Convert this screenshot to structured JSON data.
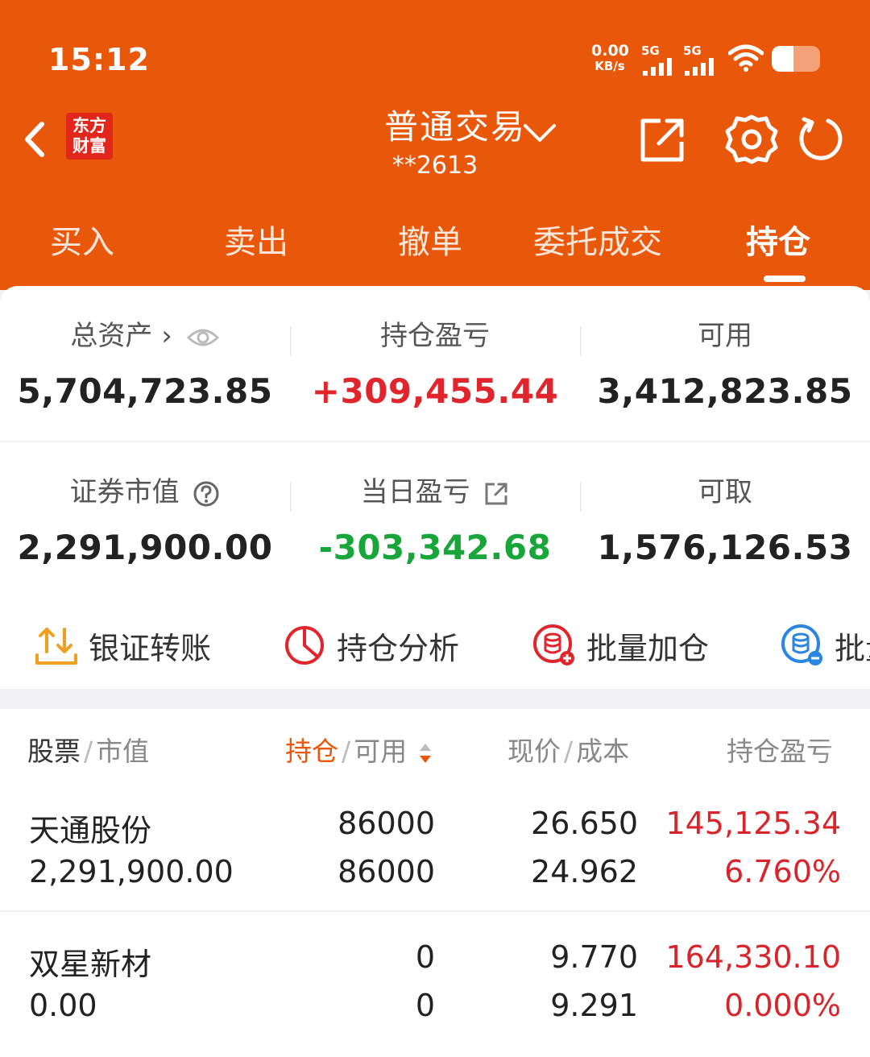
{
  "status_bar": {
    "time": "15:12",
    "net_speed": "0.00",
    "net_unit": "KB/s",
    "sim1": "5G",
    "sim2": "5G",
    "battery_level": 0.45
  },
  "header": {
    "brand_line1": "东方",
    "brand_line2": "财富",
    "title": "普通交易",
    "account": "**2613"
  },
  "tabs": [
    {
      "label": "买入"
    },
    {
      "label": "卖出"
    },
    {
      "label": "撤单"
    },
    {
      "label": "委托成交"
    },
    {
      "label": "持仓"
    }
  ],
  "summary": {
    "total_assets": {
      "label": "总资产 ›",
      "value": "5,704,723.85"
    },
    "position_pnl": {
      "label": "持仓盈亏",
      "value": "+309,455.44"
    },
    "available": {
      "label": "可用",
      "value": "3,412,823.85"
    },
    "market_value": {
      "label": "证券市值",
      "value": "2,291,900.00"
    },
    "daily_pnl": {
      "label": "当日盈亏",
      "value": "-303,342.68"
    },
    "withdrawable": {
      "label": "可取",
      "value": "1,576,126.53"
    }
  },
  "actions": [
    {
      "label": "银证转账",
      "icon": "transfer-icon"
    },
    {
      "label": "持仓分析",
      "icon": "pie-chart-icon"
    },
    {
      "label": "批量加仓",
      "icon": "batch-add-icon"
    },
    {
      "label": "批量",
      "icon": "batch-reduce-icon"
    }
  ],
  "holdings": {
    "headers": {
      "stock": "股票",
      "market_value": "市值",
      "position": "持仓",
      "available": "可用",
      "price": "现价",
      "cost": "成本",
      "pnl": "持仓盈亏"
    },
    "rows": [
      {
        "name": "天通股份",
        "market_value": "2,291,900.00",
        "position": "86000",
        "available": "86000",
        "price": "26.650",
        "cost": "24.962",
        "pnl": "145,125.34",
        "pnl_pct": "6.760%"
      },
      {
        "name": "双星新材",
        "market_value": "0.00",
        "position": "0",
        "available": "0",
        "price": "9.770",
        "cost": "9.291",
        "pnl": "164,330.10",
        "pnl_pct": "0.000%"
      }
    ]
  },
  "colors": {
    "brand": "#e9570a",
    "up": "#e0262c",
    "down": "#18a63a",
    "logo_red": "#e1271b"
  }
}
